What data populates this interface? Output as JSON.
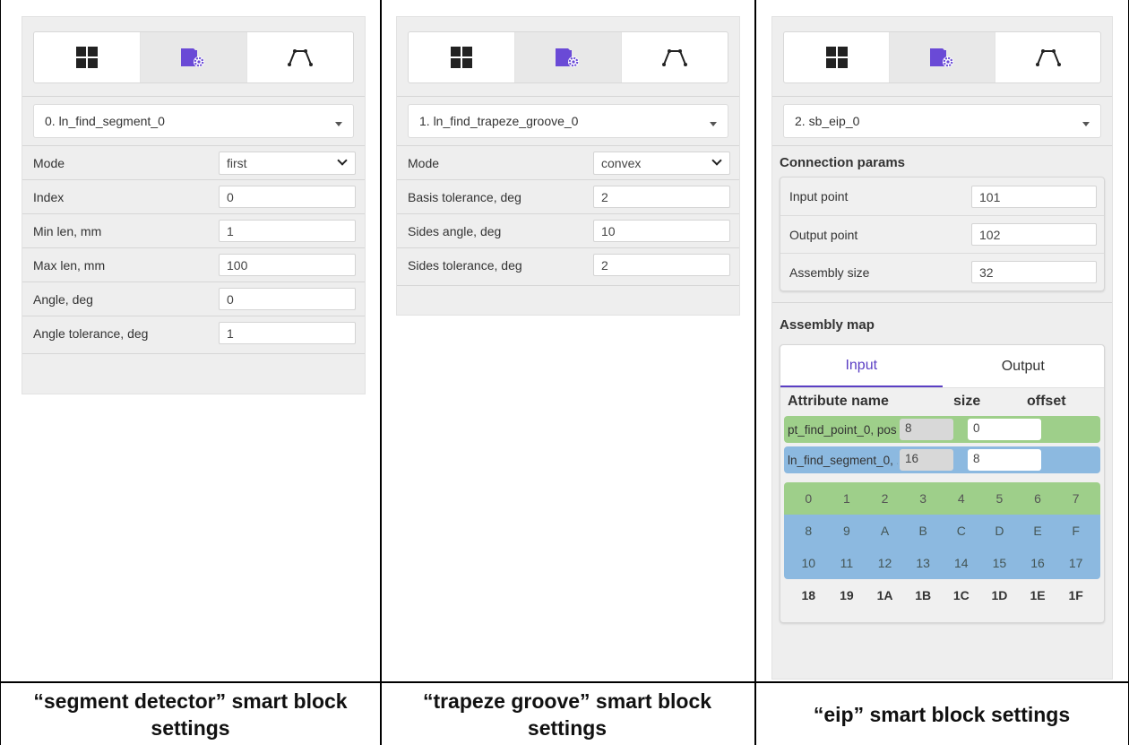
{
  "toolbar_icons": [
    "grid-icon",
    "settings-block-icon",
    "trapeze-icon"
  ],
  "colors": {
    "accent": "#5b3fc4",
    "panel_bg": "#eeeeee",
    "green_area": "#9ecf8a",
    "blue_area": "#8cb9e0"
  },
  "panels": [
    {
      "block_select": "0. ln_find_segment_0",
      "rows": [
        {
          "label": "Mode",
          "value": "first",
          "type": "select"
        },
        {
          "label": "Index",
          "value": "0",
          "type": "input"
        },
        {
          "label": "Min len, mm",
          "value": "1",
          "type": "input"
        },
        {
          "label": "Max len, mm",
          "value": "100",
          "type": "input"
        },
        {
          "label": "Angle, deg",
          "value": "0",
          "type": "input"
        },
        {
          "label": "Angle tolerance, deg",
          "value": "1",
          "type": "input"
        }
      ],
      "caption": "“segment detector” smart block settings"
    },
    {
      "block_select": "1. ln_find_trapeze_groove_0",
      "rows": [
        {
          "label": "Mode",
          "value": "convex",
          "type": "select"
        },
        {
          "label": "Basis tolerance, deg",
          "value": "2",
          "type": "input"
        },
        {
          "label": "Sides angle, deg",
          "value": "10",
          "type": "input"
        },
        {
          "label": "Sides tolerance, deg",
          "value": "2",
          "type": "input"
        }
      ],
      "caption": "“trapeze groove” smart block settings"
    },
    {
      "block_select": "2. sb_eip_0",
      "connection_title": "Connection params",
      "connection_rows": [
        {
          "label": "Input point",
          "value": "101"
        },
        {
          "label": "Output point",
          "value": "102"
        },
        {
          "label": "Assembly size",
          "value": "32"
        }
      ],
      "assembly_title": "Assembly map",
      "tabs": [
        "Input",
        "Output"
      ],
      "active_tab": "Input",
      "attr_headers": {
        "name": "Attribute name",
        "size": "size",
        "offset": "offset"
      },
      "attributes": [
        {
          "name": "pt_find_point_0, pos",
          "size": "8",
          "offset": "0"
        },
        {
          "name": "ln_find_segment_0, ...",
          "size": "16",
          "offset": "8"
        }
      ],
      "byte_rows": [
        [
          "0",
          "1",
          "2",
          "3",
          "4",
          "5",
          "6",
          "7"
        ],
        [
          "8",
          "9",
          "A",
          "B",
          "C",
          "D",
          "E",
          "F"
        ],
        [
          "10",
          "11",
          "12",
          "13",
          "14",
          "15",
          "16",
          "17"
        ],
        [
          "18",
          "19",
          "1A",
          "1B",
          "1C",
          "1D",
          "1E",
          "1F"
        ]
      ],
      "caption": "“eip” smart block settings"
    }
  ]
}
